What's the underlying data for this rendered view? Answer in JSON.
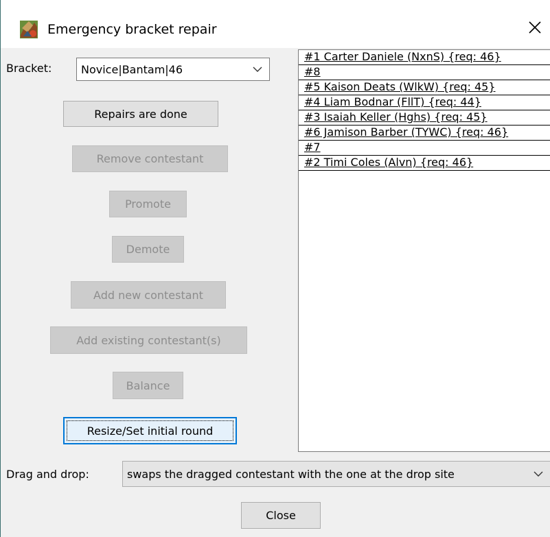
{
  "window": {
    "title": "Emergency bracket repair"
  },
  "bracket": {
    "label": "Bracket:",
    "value": "Novice|Bantam|46"
  },
  "buttons": {
    "repairs_done": "Repairs are done",
    "remove_contestant": "Remove contestant",
    "promote": "Promote",
    "demote": "Demote",
    "add_new_contestant": "Add new contestant",
    "add_existing_contestants": "Add existing contestant(s)",
    "balance": "Balance",
    "resize_initial_round": "Resize/Set initial round",
    "close": "Close"
  },
  "contestants": [
    "#1 Carter Daniele (NxnS) {req: 46}",
    "#8",
    "#5 Kaison Deats (WlkW) {req: 45}",
    "#4 Liam Bodnar (FllT) {req: 44}",
    "#3 Isaiah Keller (Hghs) {req: 45}",
    "#6 Jamison Barber (TYWC) {req: 46}",
    "#7",
    "#2 Timi Coles (Alvn) {req: 46}"
  ],
  "drag_and_drop": {
    "label": "Drag and drop:",
    "value": "swaps the dragged contestant with the one at the drop site"
  }
}
